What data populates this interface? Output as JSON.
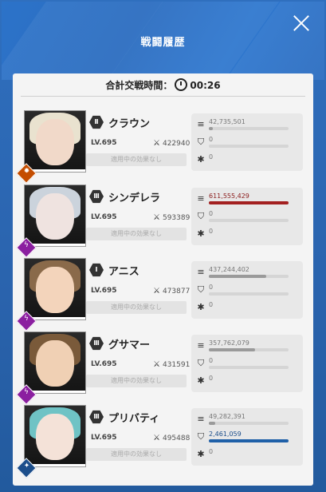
{
  "title": "戦闘履歴",
  "total": {
    "label": "合計交戦時間：",
    "time": "00:26"
  },
  "buff_label": "適用中の効果なし",
  "rows": [
    {
      "name": "クラウン",
      "burst": "Ⅱ",
      "level": "LV.695",
      "power": "422940",
      "element_color": "#c44d00",
      "element": "✹",
      "damage": "42,735,501",
      "damage_fill": 0.05,
      "heal": "0",
      "heal_fill": 0,
      "shield": "0",
      "highlight": "none",
      "hair": "#e9e2cf",
      "skin": "#f1d9c9"
    },
    {
      "name": "シンデレラ",
      "burst": "Ⅲ",
      "level": "LV.695",
      "power": "593389",
      "element_color": "#8b1fa0",
      "element": "ϟ",
      "damage": "611,555,429",
      "damage_fill": 1.0,
      "heal": "0",
      "heal_fill": 0,
      "shield": "0",
      "highlight": "damage",
      "hair": "#cbd3dc",
      "skin": "#efe3e0"
    },
    {
      "name": "アニス",
      "burst": "Ⅰ",
      "level": "LV.695",
      "power": "473877",
      "element_color": "#8b1fa0",
      "element": "ϟ",
      "damage": "437,244,402",
      "damage_fill": 0.72,
      "heal": "0",
      "heal_fill": 0,
      "shield": "0",
      "highlight": "none",
      "hair": "#8a6a4a",
      "skin": "#f3d4bb"
    },
    {
      "name": "グサマー",
      "burst": "Ⅲ",
      "level": "LV.695",
      "power": "431591",
      "element_color": "#8b1fa0",
      "element": "ϟ",
      "damage": "357,762,079",
      "damage_fill": 0.58,
      "heal": "0",
      "heal_fill": 0,
      "shield": "0",
      "highlight": "none",
      "hair": "#7a5a3a",
      "skin": "#f0d0b4"
    },
    {
      "name": "プリバティ",
      "burst": "Ⅲ",
      "level": "LV.695",
      "power": "495488",
      "element_color": "#1c4e8b",
      "element": "✦",
      "damage": "49,282,391",
      "damage_fill": 0.08,
      "heal": "2,461,059",
      "heal_fill": 1.0,
      "shield": "0",
      "highlight": "heal",
      "hair": "#6fc3c5",
      "skin": "#f4e2d8"
    }
  ]
}
